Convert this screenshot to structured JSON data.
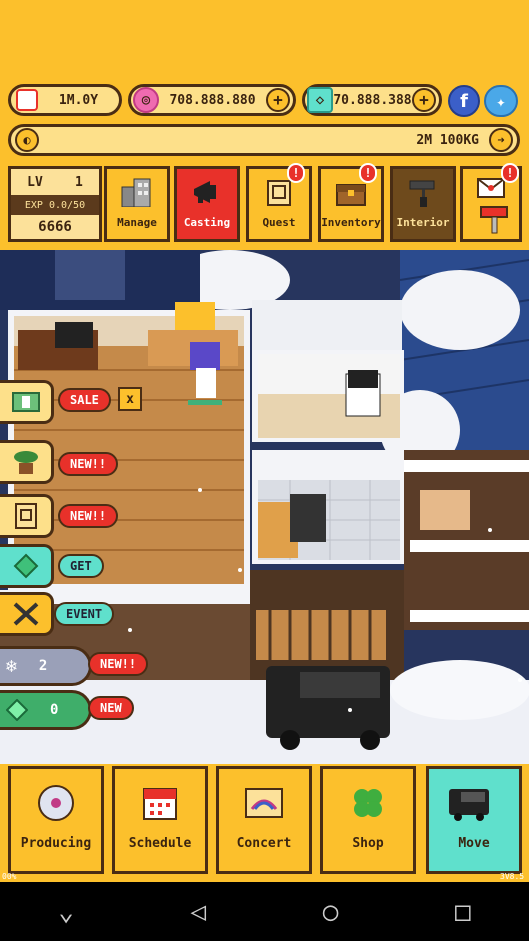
{
  "resources": {
    "date": "1M.0Y",
    "gems": "708.888.880",
    "diamonds": "70.888.388",
    "weight": "2M 100KG"
  },
  "player": {
    "lv_label": "LV",
    "level": "1",
    "exp": "EXP 0.0/50",
    "coins": "6666"
  },
  "menu": [
    {
      "label": "Manage"
    },
    {
      "label": "Casting"
    },
    {
      "label": "Quest"
    },
    {
      "label": "Inventory"
    },
    {
      "label": "Interior"
    }
  ],
  "side": {
    "sale": "SALE",
    "sale_close": "x",
    "new1": "NEW!!",
    "new2": "NEW!!",
    "get": "GET",
    "event": "EVENT",
    "counter1": "2",
    "counter1_tag": "NEW!!",
    "counter2": "0",
    "counter2_tag": "NEW"
  },
  "nav": [
    {
      "label": "Producing"
    },
    {
      "label": "Schedule"
    },
    {
      "label": "Concert"
    },
    {
      "label": "Shop"
    },
    {
      "label": "Move"
    }
  ],
  "corner": {
    "left": "00%",
    "right": "3V8.5"
  },
  "alerts": {
    "quest": "!",
    "inventory": "!",
    "mail": "!"
  },
  "colors": {
    "brand_yellow": "#fcc02c",
    "accent_red": "#e8312a",
    "teal": "#5fe0cc",
    "outline": "#4a2d14"
  }
}
